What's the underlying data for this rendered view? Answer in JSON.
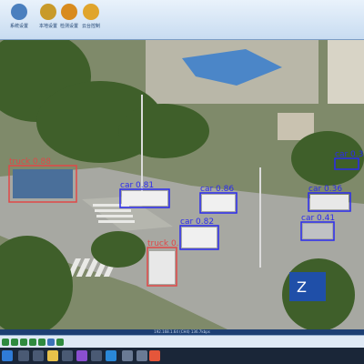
{
  "toolbar": {
    "buttons": [
      {
        "label": "系统设置",
        "icon": "settings-gear-icon",
        "color": "#4a7fbe"
      },
      {
        "label": "本地设置",
        "icon": "local-settings-icon",
        "color": "#c89a2a"
      },
      {
        "label": "检测设置",
        "icon": "detect-settings-icon",
        "color": "#d88b1e"
      },
      {
        "label": "云台控制",
        "icon": "ptz-control-icon",
        "color": "#e0a52c"
      }
    ]
  },
  "video": {
    "road_sign_text": "Z",
    "detections": [
      {
        "label": "truck 0.88",
        "color": "#e04848"
      },
      {
        "label": "car 0.81",
        "color": "#2a2af0"
      },
      {
        "label": "car 0.86",
        "color": "#2a2af0"
      },
      {
        "label": "car 0.82",
        "color": "#2a2af0"
      },
      {
        "label": "truck 0.",
        "color": "#e04848"
      },
      {
        "label": "car 0.3",
        "color": "#2a2af0"
      },
      {
        "label": "car 0.36",
        "color": "#2a2af0"
      },
      {
        "label": "car 0.41",
        "color": "#2a2af0"
      }
    ]
  },
  "status_bar": {
    "text": "192.168.1.64 (CH4) 136.7kbps"
  },
  "colors": {
    "toolbar_bg": "#d6e5f5",
    "frame_bg": "#2b5d9e",
    "taskbar_bg": "#1a2638"
  }
}
